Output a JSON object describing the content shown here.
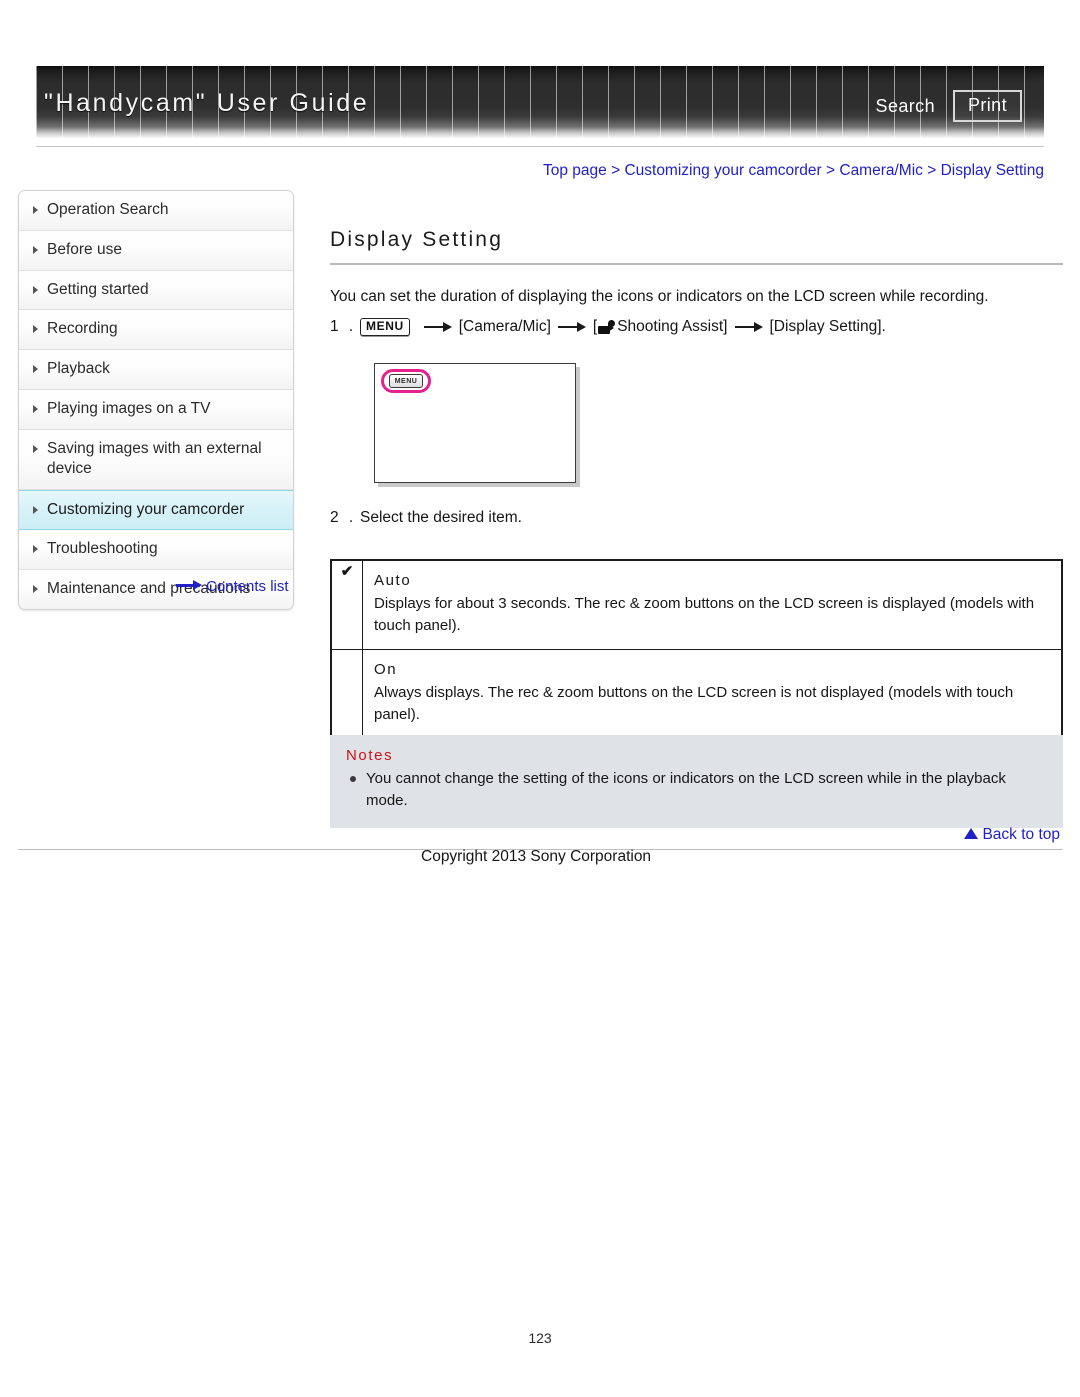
{
  "header": {
    "title": "\"Handycam\" User Guide",
    "search_label": "Search",
    "print_label": "Print"
  },
  "sidebar": {
    "items": [
      {
        "label": "Operation Search",
        "active": false
      },
      {
        "label": "Before use",
        "active": false
      },
      {
        "label": "Getting started",
        "active": false
      },
      {
        "label": "Recording",
        "active": false
      },
      {
        "label": "Playback",
        "active": false
      },
      {
        "label": "Playing images on a TV",
        "active": false
      },
      {
        "label": "Saving images with an external device",
        "active": false
      },
      {
        "label": "Customizing your camcorder",
        "active": true
      },
      {
        "label": "Troubleshooting",
        "active": false
      },
      {
        "label": "Maintenance and precautions",
        "active": false
      }
    ],
    "contents_link": "Contents list"
  },
  "breadcrumb": {
    "text": "Top page > Customizing your camcorder > Camera/Mic > Display Setting"
  },
  "main": {
    "title": "Display Setting",
    "intro": "You can set the duration of displaying the icons or indicators on the LCD screen while recording.",
    "step1": {
      "number": "1 .",
      "menu_chip": "MENU",
      "part1": "[Camera/Mic]",
      "part2_prefix": "[",
      "part2": "Shooting Assist]",
      "part3": "[Display Setting]."
    },
    "step2": {
      "number": "2 .",
      "text": "Select the desired item."
    },
    "lcd_menu_label": "MENU",
    "options": [
      {
        "checked": "✔",
        "name": "Auto",
        "description": "Displays for about 3 seconds. The rec & zoom buttons on the LCD screen is displayed (models with touch panel)."
      },
      {
        "checked": "",
        "name": "On",
        "description": "Always displays. The rec & zoom buttons on the LCD screen is not displayed (models with touch panel)."
      }
    ],
    "notes": {
      "title": "Notes",
      "items": [
        "You cannot change the setting of the icons or indicators on the LCD screen while in the playback mode."
      ]
    },
    "back_to_top": "Back to top",
    "copyright": "Copyright 2013 Sony Corporation",
    "page_number": "123"
  },
  "colors": {
    "link": "#2121c7",
    "notes_title": "#c8141e",
    "highlight_bg": "#cdeef6",
    "menu_highlight": "#e5218f",
    "notes_bg": "#dfe3e8"
  }
}
